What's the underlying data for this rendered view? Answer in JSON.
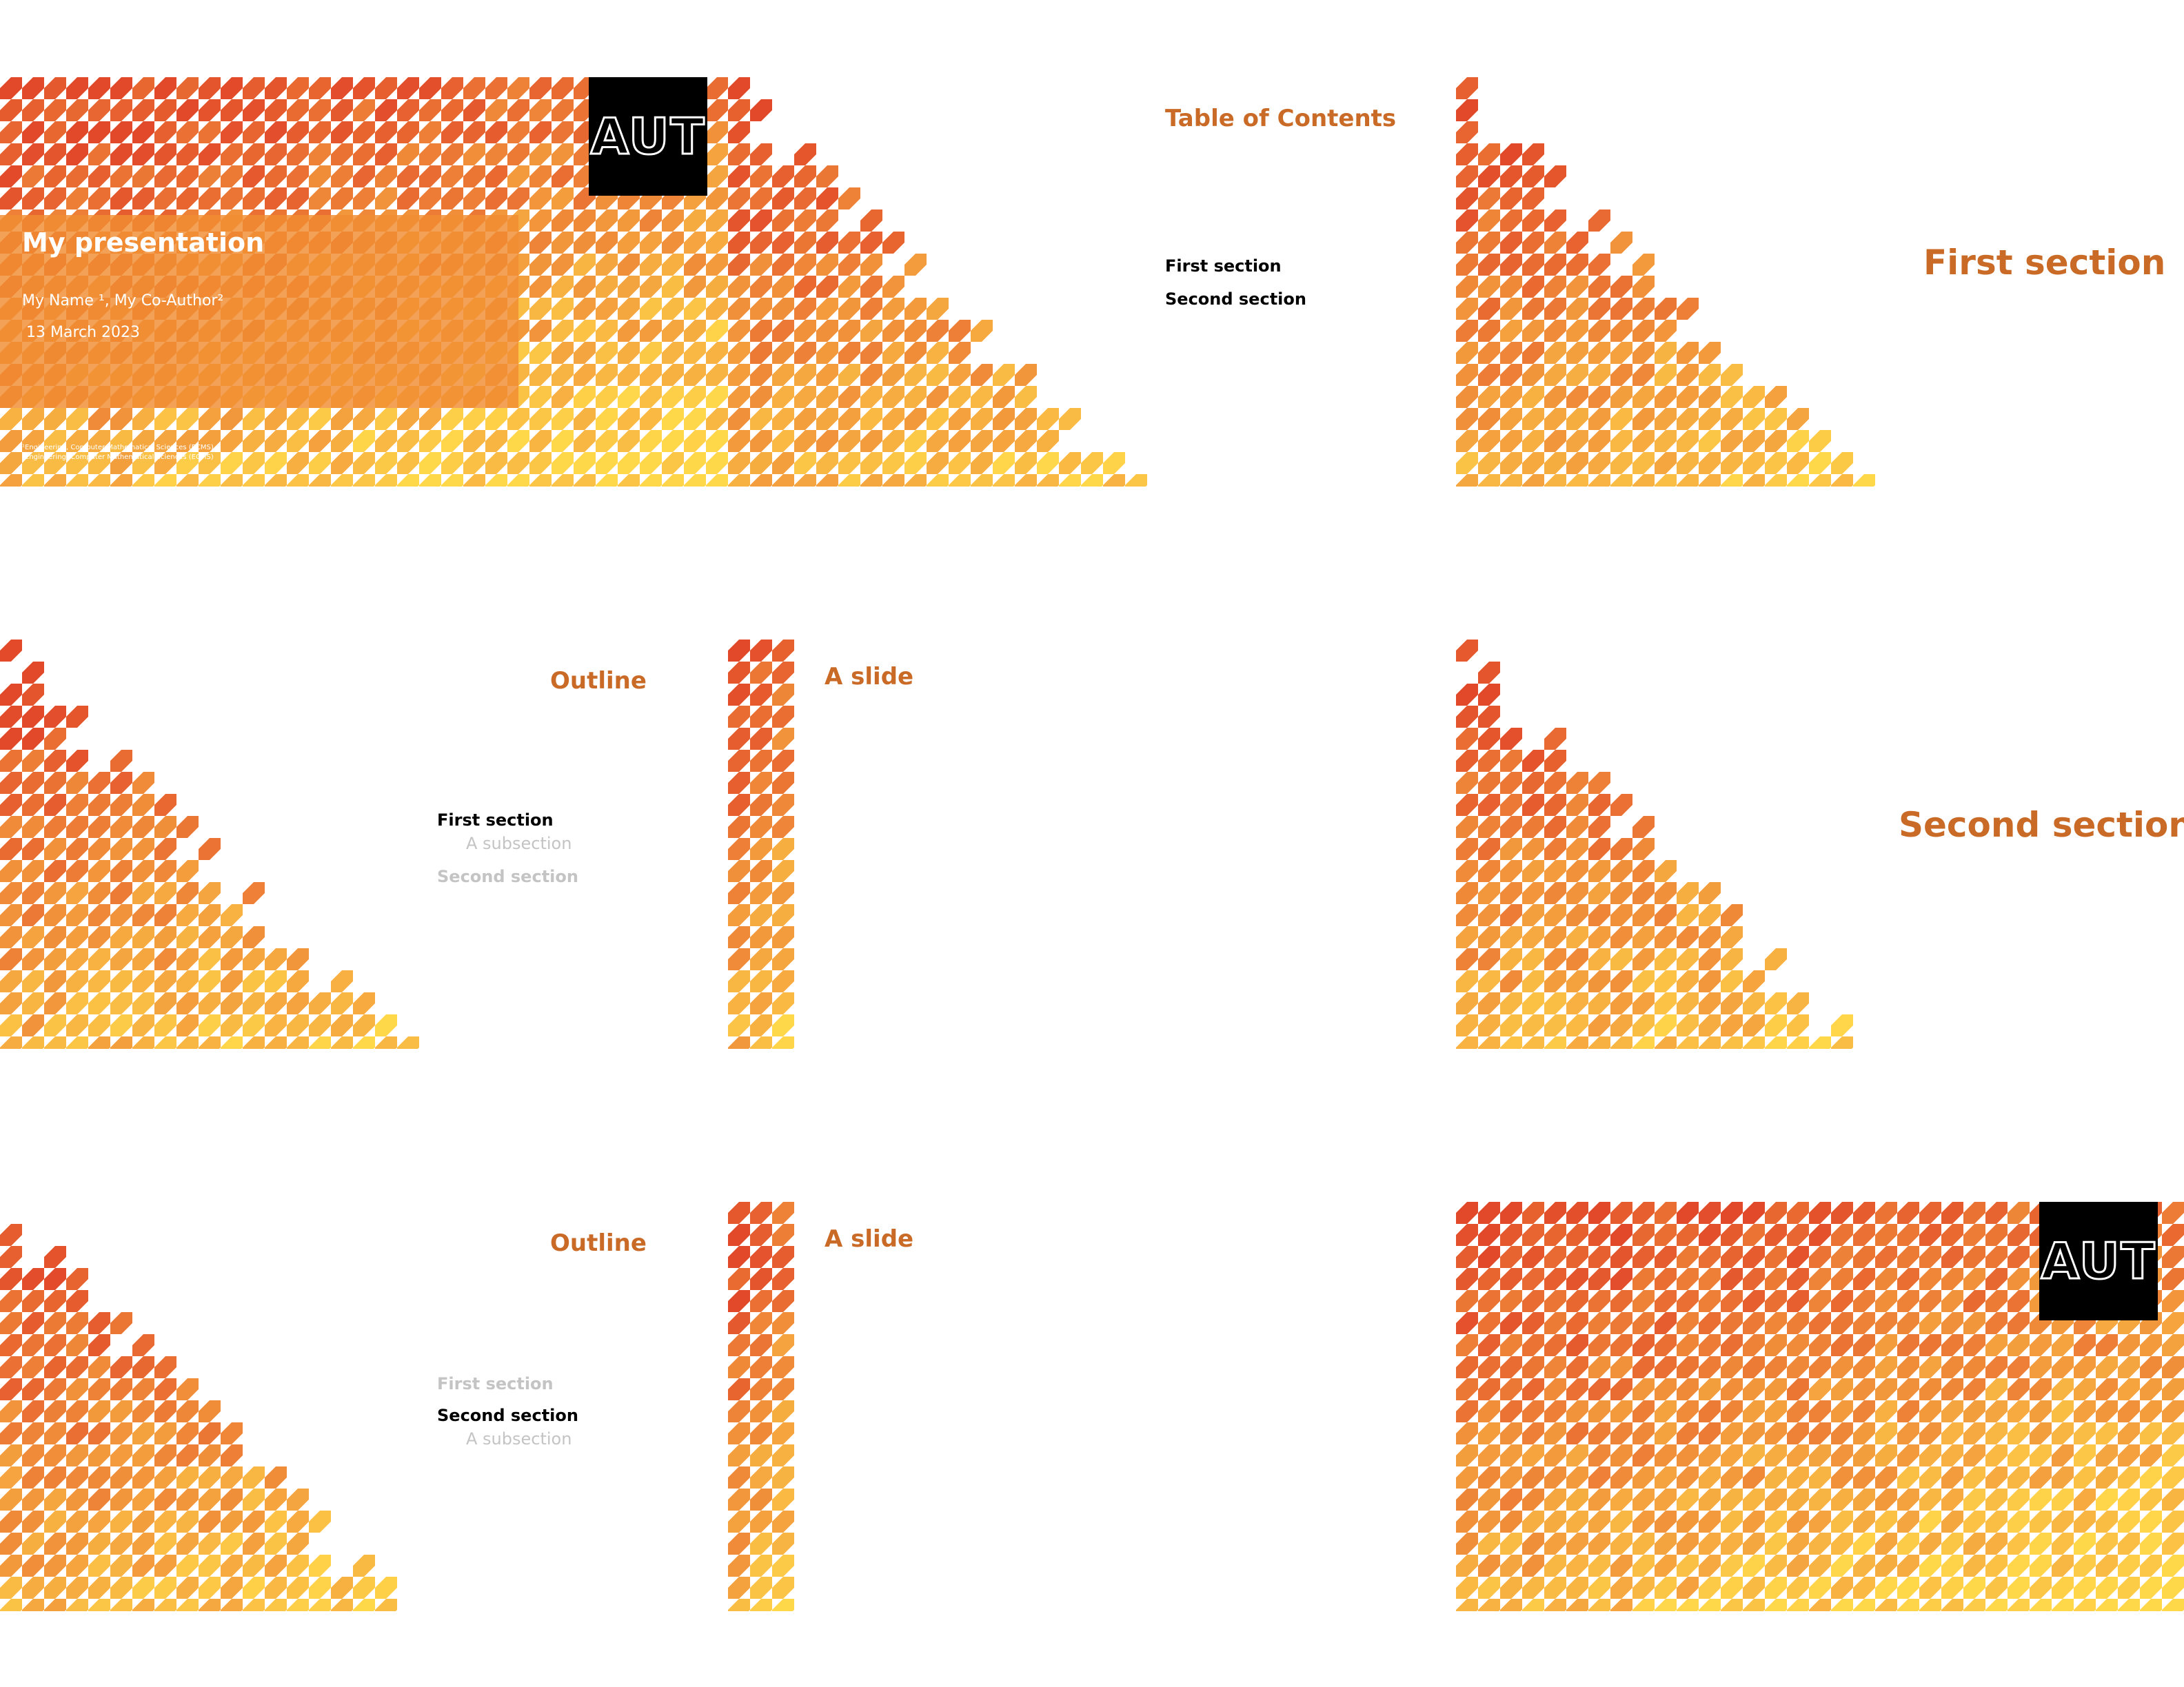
{
  "logo_text": "AUT",
  "colors": {
    "accent": "#c96a26",
    "dim": "#c4c4c4",
    "pattern_light": "#ffd84a",
    "pattern_dark": "#e2482a"
  },
  "title_slide": {
    "title": "My presentation",
    "authors": "My Name ¹, My Co-Author²",
    "date": "13 March 2023",
    "affiliation_1": "¹Engineering, Computer Mathematical Sciences (ECMS)",
    "affiliation_2": "²Engineering, Computer Mathematical Sciences (ECMS)"
  },
  "toc_slide": {
    "title": "Table of Contents",
    "items": [
      "First section",
      "Second section"
    ]
  },
  "section1_slide": {
    "title": "First section"
  },
  "outline1_slide": {
    "title": "Outline",
    "item1": "First section",
    "item1_sub": "A subsection",
    "item2": "Second section"
  },
  "slide_a": {
    "title": "A slide"
  },
  "section2_slide": {
    "title": "Second section"
  },
  "outline2_slide": {
    "title": "Outline",
    "item1": "First section",
    "item2": "Second section",
    "item2_sub": "A subsection"
  },
  "slide_b": {
    "title": "A slide"
  }
}
